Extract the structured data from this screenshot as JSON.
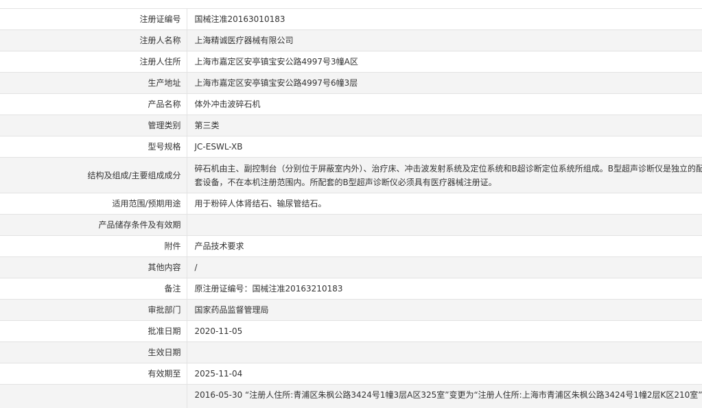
{
  "registration": {
    "rows": [
      {
        "label": "注册证编号",
        "value": "国械注准20163010183"
      },
      {
        "label": "注册人名称",
        "value": "上海精诚医疗器械有限公司"
      },
      {
        "label": "注册人住所",
        "value": "上海市嘉定区安亭镇宝安公路4997号3幢A区"
      },
      {
        "label": "生产地址",
        "value": "上海市嘉定区安亭镇宝安公路4997号6幢3层"
      },
      {
        "label": "产品名称",
        "value": "体外冲击波碎石机"
      },
      {
        "label": "管理类别",
        "value": "第三类"
      },
      {
        "label": "型号规格",
        "value": "JC-ESWL-XB"
      },
      {
        "label": "结构及组成/主要组成成分",
        "value": "碎石机由主、副控制台（分别位于屏蔽室内外）、治疗床、冲击波发射系统及定位系统和B超诊断定位系统所组成。B型超声诊断仪是独立的配套设备，不在本机注册范围内。所配套的B型超声诊断仪必须具有医疗器械注册证。"
      },
      {
        "label": "适用范围/预期用途",
        "value": "用于粉碎人体肾结石、输尿管结石。"
      },
      {
        "label": "产品储存条件及有效期",
        "value": ""
      },
      {
        "label": "附件",
        "value": "产品技术要求"
      },
      {
        "label": "其他内容",
        "value": "/"
      },
      {
        "label": "备注",
        "value": "原注册证编号：国械注准20163210183"
      },
      {
        "label": "审批部门",
        "value": "国家药品监督管理局"
      },
      {
        "label": "批准日期",
        "value": "2020-11-05"
      },
      {
        "label": "生效日期",
        "value": ""
      },
      {
        "label": "有效期至",
        "value": "2025-11-04"
      },
      {
        "label": "",
        "value": "2016-05-30 “注册人住所:青浦区朱枫公路3424号1幢3层A区325室”变更为“注册人住所:上海市青浦区朱枫公路3424号1幢2层K区210室”。"
      }
    ]
  }
}
